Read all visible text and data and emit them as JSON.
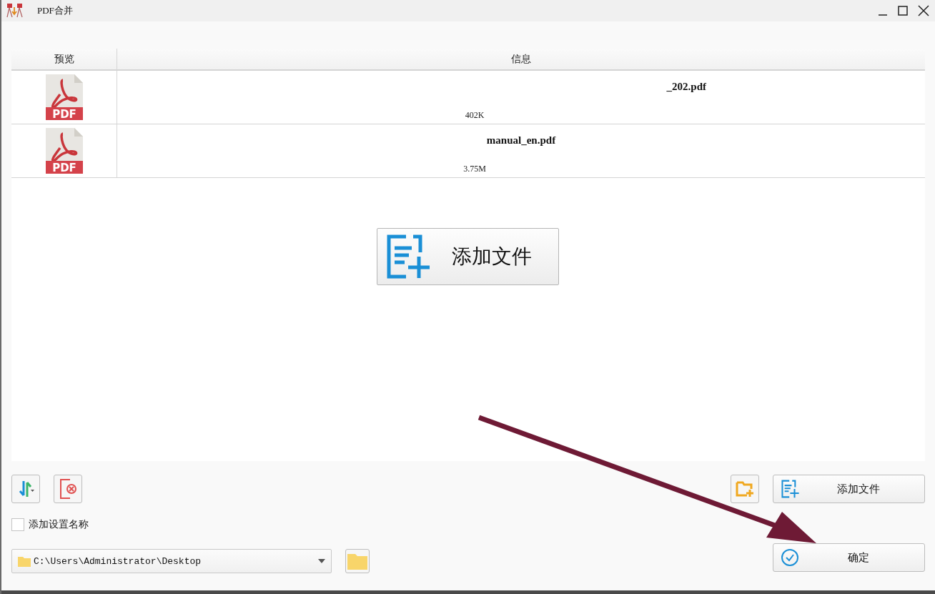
{
  "window": {
    "title": "PDF合并"
  },
  "table": {
    "columns": [
      "预览",
      "信息"
    ],
    "rows": [
      {
        "preview": "PDF",
        "name": "_202.pdf",
        "size": "402K",
        "redacted": true
      },
      {
        "preview": "PDF",
        "name": "manual_en.pdf",
        "size": "3.75M",
        "redacted": false
      }
    ]
  },
  "add_file_big": {
    "label": "添加文件"
  },
  "add_file": {
    "label": "添加文件"
  },
  "add_name_option": {
    "label": "添加设置名称",
    "checked": false
  },
  "output_path": {
    "value": "C:\\Users\\Administrator\\Desktop"
  },
  "confirm": {
    "label": "确定"
  }
}
